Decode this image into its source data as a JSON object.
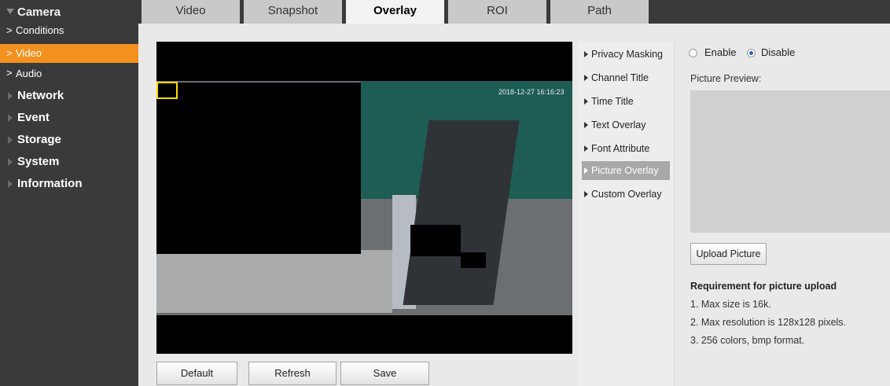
{
  "sidebar": {
    "top": "Camera",
    "items": [
      {
        "label": "Conditions"
      },
      {
        "label": "Video"
      },
      {
        "label": "Audio"
      }
    ],
    "groups": [
      "Network",
      "Event",
      "Storage",
      "System",
      "Information"
    ]
  },
  "tabs": [
    "Video",
    "Snapshot",
    "Overlay",
    "ROI",
    "Path"
  ],
  "video": {
    "timestamp": "2018-12-27 16:16:23"
  },
  "buttons": {
    "default": "Default",
    "refresh": "Refresh",
    "save": "Save"
  },
  "submenu": [
    "Privacy Masking",
    "Channel Title",
    "Time Title",
    "Text Overlay",
    "Font Attribute",
    "Picture Overlay",
    "Custom Overlay"
  ],
  "panel": {
    "enable": "Enable",
    "disable": "Disable",
    "preview_label": "Picture Preview:",
    "upload": "Upload Picture",
    "req_title": "Requirement for picture upload",
    "req1": "1. Max size is 16k.",
    "req2": "2. Max resolution is 128x128 pixels.",
    "req3": "3. 256 colors, bmp format."
  },
  "colors": {
    "accent": "#f2911e",
    "sidebar": "#3a3a3a",
    "highlight_box": "#ffdd00"
  }
}
